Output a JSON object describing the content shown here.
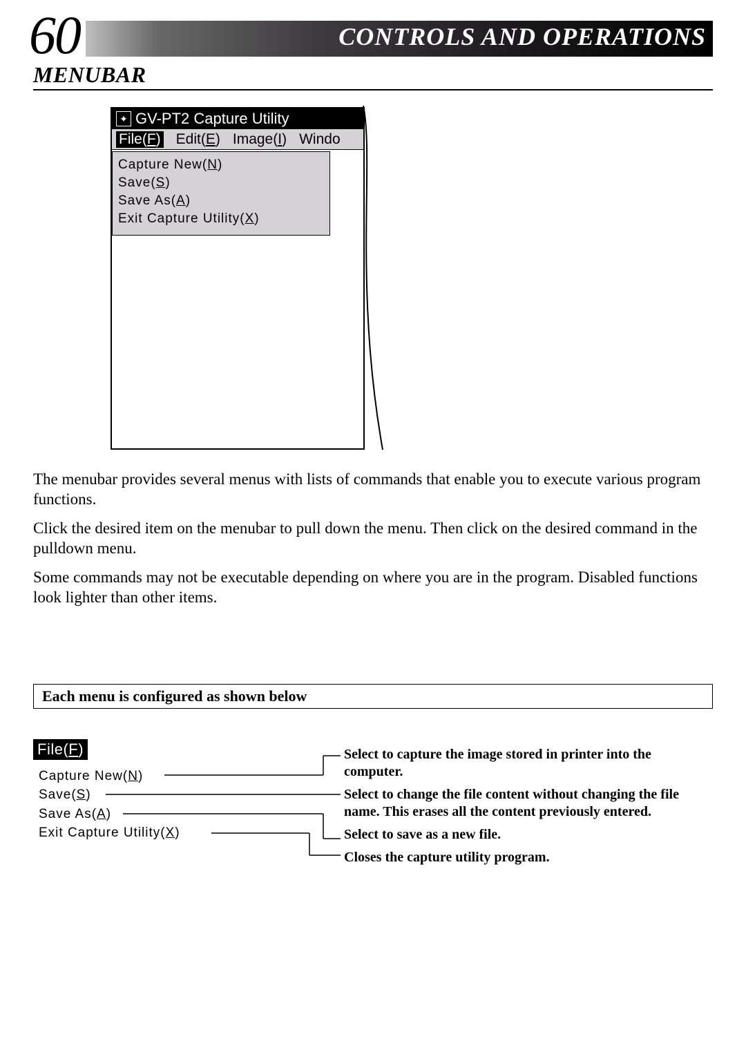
{
  "header": {
    "page_number": "60",
    "title": "CONTROLS AND OPERATIONS",
    "section": "MENUBAR"
  },
  "app": {
    "title": "GV-PT2 Capture Utility",
    "menus": {
      "file": {
        "label": "File",
        "hotkey": "F"
      },
      "edit": {
        "label": "Edit",
        "hotkey": "E"
      },
      "image": {
        "label": "Image",
        "hotkey": "I"
      },
      "window": {
        "label": "Windo"
      }
    },
    "file_menu": {
      "capture_new": {
        "label": "Capture New",
        "hotkey": "N"
      },
      "save": {
        "label": "Save",
        "hotkey": "S"
      },
      "save_as": {
        "label": "Save As",
        "hotkey": "A"
      },
      "exit": {
        "label": "Exit Capture Utility",
        "hotkey": "X"
      }
    }
  },
  "paragraphs": {
    "p1": "The menubar provides several menus with lists of commands that enable you to execute various program functions.",
    "p2": "Click the desired item on the menubar to pull down the menu. Then click on the desired command in the pulldown menu.",
    "p3": "Some commands may not be executable depending on where you are in the program.  Disabled functions look lighter than other items."
  },
  "config_heading": "Each menu is configured as shown below",
  "file_diagram_header": {
    "label": "File",
    "hotkey": "F"
  },
  "descriptions": {
    "capture_new": "Select to capture the image stored in printer into the computer.",
    "save": "Select to change the file content without changing the file name. This erases all the content previously entered.",
    "save_as": "Select to save as a new file.",
    "exit": "Closes the capture utility program."
  }
}
